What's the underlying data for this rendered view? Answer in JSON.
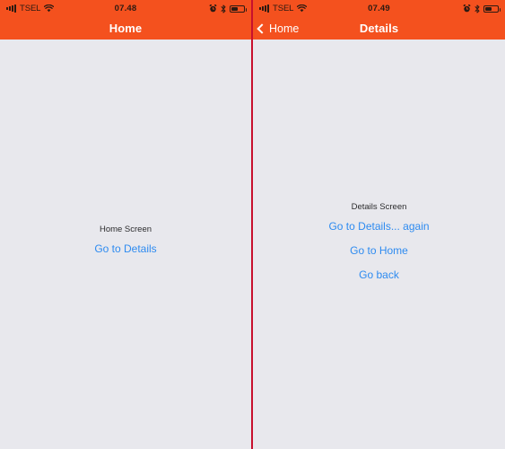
{
  "screens": [
    {
      "id": "home",
      "statusbar": {
        "carrier": "TSEL",
        "time": "07.48",
        "signal_icon": "signal-bars-icon",
        "wifi_icon": "wifi-icon",
        "alarm_icon": "alarm-clock-icon",
        "bluetooth_icon": "bluetooth-icon",
        "battery_icon": "battery-icon"
      },
      "navbar": {
        "title": "Home",
        "has_back": false,
        "back_label": "",
        "back_icon": ""
      },
      "body": {
        "label": "Home Screen",
        "links": [
          "Go to Details"
        ]
      }
    },
    {
      "id": "details",
      "statusbar": {
        "carrier": "TSEL",
        "time": "07.49",
        "signal_icon": "signal-bars-icon",
        "wifi_icon": "wifi-icon",
        "alarm_icon": "alarm-clock-icon",
        "bluetooth_icon": "bluetooth-icon",
        "battery_icon": "battery-icon"
      },
      "navbar": {
        "title": "Details",
        "has_back": true,
        "back_label": "Home",
        "back_icon": "chevron-left-icon"
      },
      "body": {
        "label": "Details Screen",
        "links": [
          "Go to Details... again",
          "Go to Home",
          "Go back"
        ]
      }
    }
  ],
  "theme": {
    "header_color": "#f4511e",
    "body_color": "#e8e8ed",
    "link_color": "#2e8bf0",
    "title_color": "#ffffff",
    "divider_color": "#c8102e",
    "status_icon_color": "#2b1a12"
  }
}
